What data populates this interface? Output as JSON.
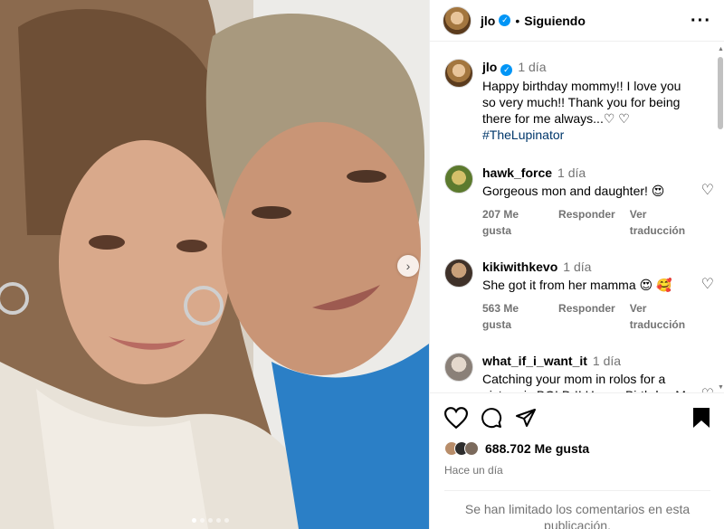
{
  "post": {
    "username": "jlo",
    "follow_status": "Siguiendo",
    "separator": "•",
    "more_icon": "more-horizontal-icon"
  },
  "caption": {
    "username": "jlo",
    "time": "1 día",
    "text": "Happy birthday mommy!! I love you so very much!! Thank you for being there for me always...♡ ♡",
    "hashtag": "#TheLupinator"
  },
  "comments": [
    {
      "username": "hawk_force",
      "time": "1 día",
      "text": "Gorgeous mon and daughter! 😍",
      "likes": "207 Me gusta",
      "reply": "Responder",
      "translate": "Ver traducción"
    },
    {
      "username": "kikiwithkevo",
      "time": "1 día",
      "text": "She got it from her mamma 😍 🥰",
      "likes": "563 Me gusta",
      "reply": "Responder",
      "translate": "Ver traducción"
    },
    {
      "username": "what_if_i_want_it",
      "time": "1 día",
      "text": "Catching your mom in rolos for a picture is BOLD !! Happy Birthday Ms Rodriguez. Que dios te bendiga siempre ❤️",
      "likes": "",
      "reply": "",
      "translate": ""
    }
  ],
  "actions": {
    "likes_count": "688.702 Me gusta",
    "posted_ago": "Hace un día",
    "comments_limited": "Se han limitado los comentarios en esta publicación."
  },
  "carousel": {
    "total_slides": 5,
    "active_slide": 1
  },
  "colors": {
    "verified": "#0095f6",
    "hashtag": "#00376b",
    "muted": "#737373"
  }
}
